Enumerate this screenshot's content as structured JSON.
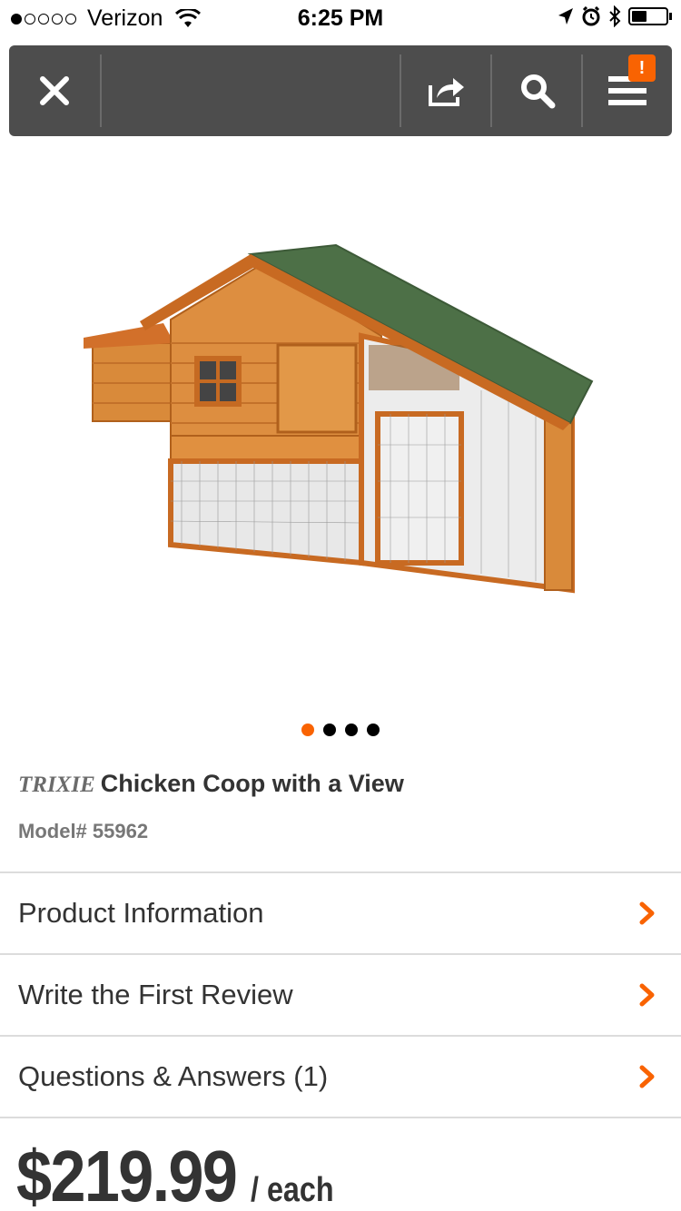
{
  "status_bar": {
    "carrier": "Verizon",
    "time": "6:25 PM",
    "battery_level": 0.45
  },
  "toolbar": {
    "menu_badge": "!"
  },
  "product": {
    "brand": "TRIXIE",
    "title": "Chicken Coop with a View",
    "model": "Model# 55962",
    "image_count": 4,
    "active_image_index": 0
  },
  "sections": [
    {
      "label": "Product Information"
    },
    {
      "label": "Write the First Review"
    },
    {
      "label": "Questions & Answers (1)"
    }
  ],
  "pricing": {
    "price": "$219.99",
    "unit": "/ each"
  },
  "colors": {
    "accent": "#f96302",
    "toolbar": "#4d4d4d",
    "text": "#333333"
  }
}
